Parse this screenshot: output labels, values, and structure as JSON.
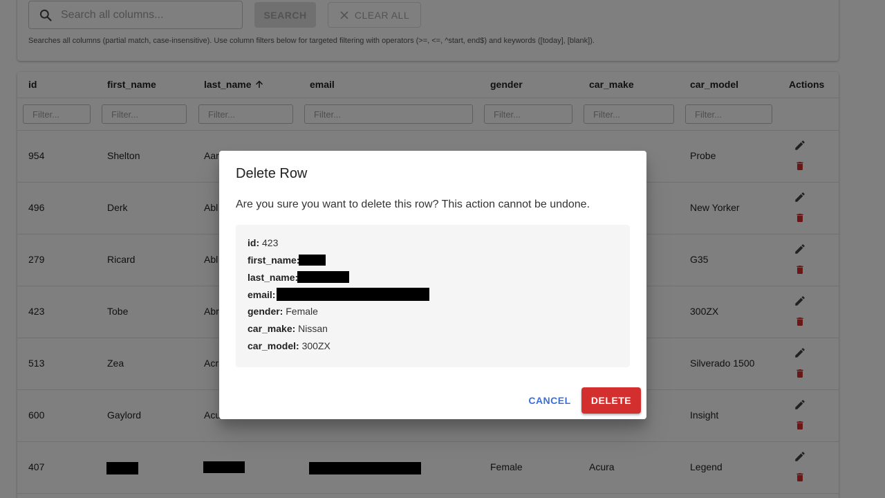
{
  "search": {
    "placeholder": "Search all columns...",
    "search_label": "SEARCH",
    "clear_label": "CLEAR ALL",
    "help_text": "Searches all columns (partial match, case-insensitive). Use column filters below for targeted filtering with operators (>=, <=, ^start, end$) and keywords ([today], [blank])."
  },
  "table": {
    "columns": [
      "id",
      "first_name",
      "last_name",
      "email",
      "gender",
      "car_make",
      "car_model",
      "Actions"
    ],
    "sorted_column": "last_name",
    "sort_direction": "ascending",
    "filter_placeholder": "Filter...",
    "rows": [
      {
        "id": "954",
        "first_name": "Shelton",
        "last_name": "Aar",
        "email": "",
        "gender": "",
        "car_make": "",
        "car_model": "Probe"
      },
      {
        "id": "496",
        "first_name": "Derk",
        "last_name": "Abl",
        "email": "",
        "gender": "",
        "car_make": "",
        "car_model": "New Yorker"
      },
      {
        "id": "279",
        "first_name": "Ricard",
        "last_name": "Abl",
        "email": "",
        "gender": "",
        "car_make": "",
        "car_model": "G35"
      },
      {
        "id": "423",
        "first_name": "Tobe",
        "last_name": "Abr",
        "email": "",
        "gender": "",
        "car_make": "",
        "car_model": "300ZX"
      },
      {
        "id": "513",
        "first_name": "Zea",
        "last_name": "Acr",
        "email": "",
        "gender": "",
        "car_make": "",
        "car_model": "Silverado 1500"
      },
      {
        "id": "600",
        "first_name": "Gaylord",
        "last_name": "Acu",
        "email": "",
        "gender": "",
        "car_make": "",
        "car_model": "Insight"
      },
      {
        "id": "407",
        "first_name": "",
        "last_name": "",
        "email": "",
        "gender": "Female",
        "car_make": "Acura",
        "car_model": "Legend"
      }
    ]
  },
  "dialog": {
    "title": "Delete Row",
    "message": "Are you sure you want to delete this row? This action cannot be undone.",
    "details": {
      "id_label": "id:",
      "id_value": "423",
      "first_name_label": "first_name:",
      "last_name_label": "last_name:",
      "email_label": "email:",
      "gender_label": "gender:",
      "gender_value": "Female",
      "car_make_label": "car_make:",
      "car_make_value": "Nissan",
      "car_model_label": "car_model:",
      "car_model_value": "300ZX"
    },
    "cancel_label": "CANCEL",
    "delete_label": "DELETE"
  },
  "colors": {
    "accent_blue": "#3b6fd9",
    "danger_red": "#d32f2f",
    "edit_icon": "#424242",
    "overlay": "rgba(0,0,0,0.5)"
  },
  "icons": [
    "search-icon",
    "close-icon",
    "arrow-up-icon",
    "pencil-icon",
    "trash-icon"
  ]
}
